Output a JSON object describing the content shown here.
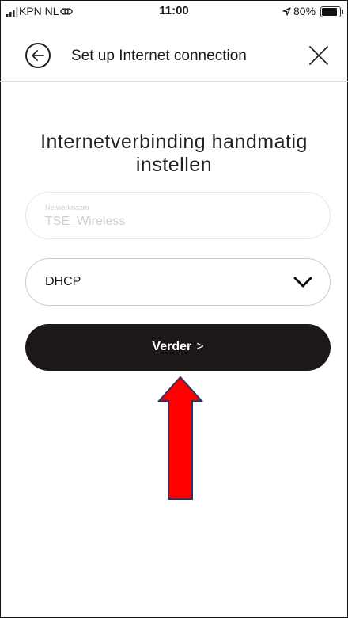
{
  "status_bar": {
    "carrier": "KPN NL",
    "time": "11:00",
    "battery": "80%"
  },
  "header": {
    "title": "Set up Internet connection"
  },
  "main": {
    "heading": "Internetverbinding handmatig instellen",
    "network_field": {
      "label": "Netwerknaam",
      "value": "TSE_Wireless"
    },
    "connection_type": {
      "selected": "DHCP"
    },
    "next_button": {
      "label": "Verder",
      "chevron": ">"
    }
  },
  "annotation": {
    "arrow_color": "#ff0000",
    "arrow_outline": "#1f3864"
  },
  "colors": {
    "button_bg": "#1c1818",
    "divider": "#d9d9d9"
  }
}
